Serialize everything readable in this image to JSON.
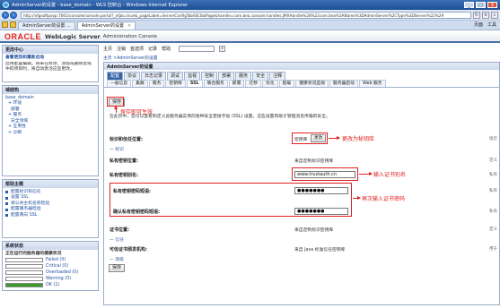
{
  "window": {
    "title": "AdminServer的设置 - base_domain - WLS 控制台 - Windows Internet Explorer",
    "url": "http://xfgsoftpoop:7001/console/console.portal?_nfpb=true&_pageLabel=ServerConfigTabSSLTabPage&handle=com.bea.console.handles.JMXHandle%28%22com.bea%3AName%3DAdminServer%2CType%3DServer%22%29",
    "buttons": [
      "_",
      "□",
      "X"
    ]
  },
  "browser_tabs": [
    {
      "label": "AdminServer的设置 ..."
    },
    {
      "label": "AdminServer的设置"
    }
  ],
  "browser_tools": [
    "页面",
    "工具"
  ],
  "header": {
    "brand": "ORACLE",
    "product": "WebLogic Server",
    "sub": "Administration Console"
  },
  "toolbar": {
    "items": [
      "主页",
      "注销",
      "首选项",
      "记录",
      "帮助"
    ]
  },
  "breadcrumb": "主页 >AdminServer的设置",
  "sidebar": {
    "change_center": {
      "title": "更改中心",
      "link": "查看更改和重新启动",
      "text": "启用配置编辑。将来在修改、添加或删除此域中的项目时，将自动激活这些更改。"
    },
    "domain_structure": {
      "title": "域结构",
      "items": [
        "base_domain",
        "+ 环境",
        "部署",
        "+ 服务",
        "安全领域",
        "+ 互用性",
        "+ 诊断"
      ]
    },
    "help": {
      "title": "帮助主题",
      "items": [
        "配置标识和信任",
        "设置 SSL",
        "将公共主机名称检验",
        "配置服务器检验",
        "配置两向 SSL"
      ]
    },
    "status": {
      "title": "系统状态",
      "subtitle": "正在运行的服务器的健康状况",
      "rows": [
        {
          "label": "Failed (0)",
          "fill": 0,
          "color": "#d9d9d9"
        },
        {
          "label": "Critical (0)",
          "fill": 0,
          "color": "#d9d9d9"
        },
        {
          "label": "Overloaded (0)",
          "fill": 0,
          "color": "#d9d9d9"
        },
        {
          "label": "Warning (0)",
          "fill": 0,
          "color": "#d9d9d9"
        },
        {
          "label": "OK (1)",
          "fill": 1,
          "color": "#3a9a2a"
        }
      ]
    }
  },
  "content": {
    "title": "AdminServer的设置",
    "tabs": [
      "配置",
      "协议",
      "日志记录",
      "调试",
      "监视",
      "控制",
      "部署",
      "服务",
      "安全",
      "注释"
    ],
    "subtabs": [
      "一般信息",
      "集群",
      "服务",
      "密钥库",
      "SSL",
      "联合服务",
      "部署",
      "迁移",
      "优化",
      "超载",
      "健康状况监视",
      "服务器启动",
      "Web 服务"
    ],
    "save": "保存",
    "description": "在此页中，您可以查看和定义此服务器实例的各种安全套接字层 (SSL) 设置。这些设置有助于管理消息传输的安全。",
    "fields": {
      "identity_label": "标识和信任位置:",
      "identity_value": "密钥库",
      "change_btn": "更改",
      "identity_section": "— 标识",
      "privkey_loc_label": "私有密钥位置:",
      "privkey_loc_value": "来自定制标识密钥库",
      "alias_label": "私有密钥别名:",
      "alias_value": "www.trustauth.cn",
      "pass_label": "私有密钥密码短语:",
      "pass_value": "●●●●●●●",
      "confirm_label": "确认私有密钥密码短语:",
      "confirm_value": "●●●●●●●",
      "cert_loc_label": "证书位置:",
      "cert_loc_value": "来自定制标识密钥库",
      "trust_section": "— 信任",
      "trusted_label": "可信证书颁发机构:",
      "trusted_value": "来自 Java 标准信任密钥库",
      "advanced": "— 高级"
    },
    "right_notes": [
      "指示",
      "定义",
      "私有",
      "私有",
      "私有",
      "定义",
      "用于"
    ]
  },
  "annotations": {
    "save": "保存即可生效",
    "change": "更改为秘钥库",
    "alias": "输入证书别名",
    "password": "再次输入证书密码"
  }
}
